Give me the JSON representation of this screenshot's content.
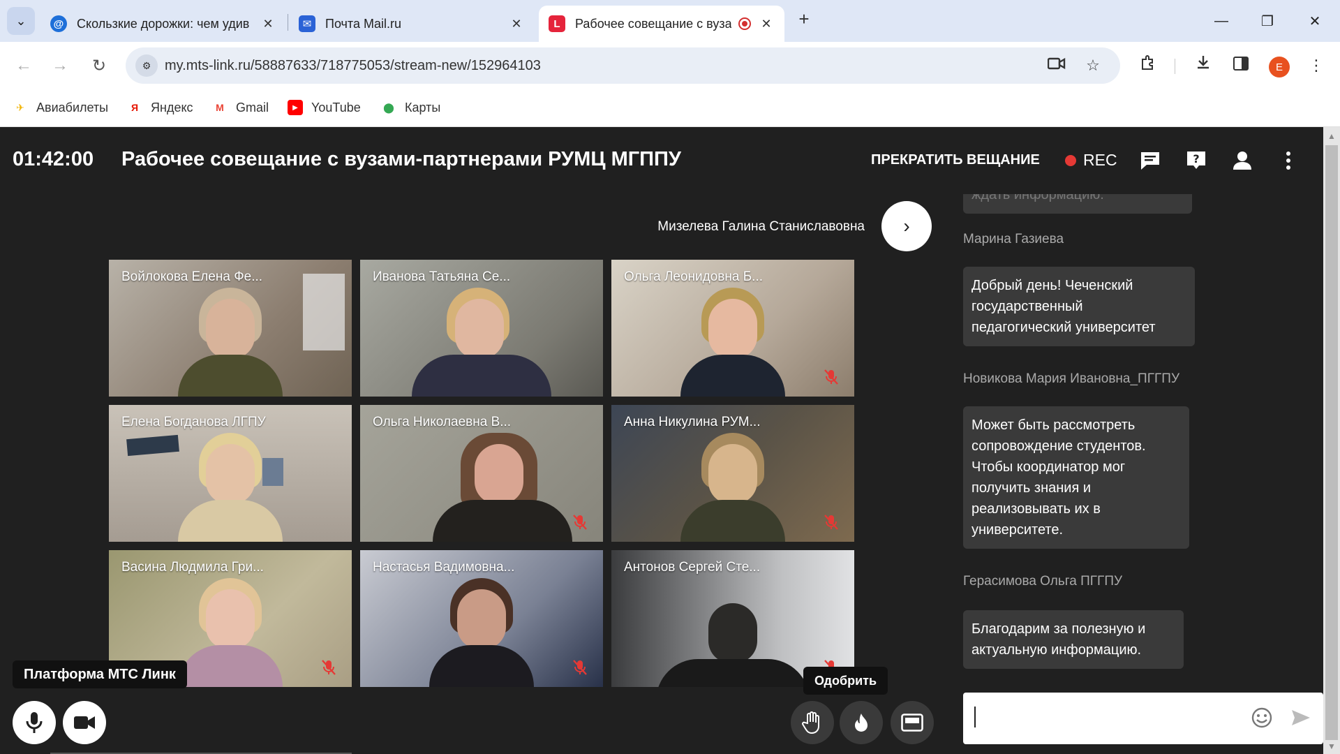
{
  "browser": {
    "tabs": [
      {
        "title": "Скользкие дорожки: чем удив",
        "favicon": "mail-at-icon"
      },
      {
        "title": "Почта Mail.ru",
        "favicon": "envelope-icon"
      },
      {
        "title": "Рабочее совещание с вуза",
        "favicon": "mts-link-icon"
      }
    ],
    "url": "my.mts-link.ru/58887633/718775053/stream-new/152964103",
    "profile_initial": "E",
    "bookmarks": [
      {
        "label": "Авиабилеты",
        "icon": "plane-icon"
      },
      {
        "label": "Яндекс",
        "icon": "yandex-icon"
      },
      {
        "label": "Gmail",
        "icon": "gmail-icon"
      },
      {
        "label": "YouTube",
        "icon": "youtube-icon"
      },
      {
        "label": "Карты",
        "icon": "maps-pin-icon"
      }
    ]
  },
  "webinar": {
    "timer": "01:42:00",
    "title": "Рабочее совещание с вузами-партнерами РУМЦ МГППУ",
    "stop_label": "ПРЕКРАТИТЬ ВЕЩАНИЕ",
    "rec_label": "REC",
    "current_speaker": "Мизелева Галина Станиславовна",
    "participants": [
      {
        "name": "Войлокова Елена Фе...",
        "muted": false
      },
      {
        "name": "Иванова Татьяна Се...",
        "muted": false
      },
      {
        "name": "Ольга Леонидовна Б...",
        "muted": true
      },
      {
        "name": "Елена Богданова ЛГПУ",
        "muted": false
      },
      {
        "name": "Ольга Николаевна В...",
        "muted": true
      },
      {
        "name": "Анна Никулина РУМ...",
        "muted": true
      },
      {
        "name": "Васина Людмила Гри...",
        "muted": true
      },
      {
        "name": "Настасья Вадимовна...",
        "muted": true
      },
      {
        "name": "Антонов Сергей Сте...",
        "muted": true
      }
    ],
    "brand_tooltip": "Платформа МТС Линк",
    "approve_tooltip": "Одобрить"
  },
  "chat": {
    "partial_message": "ждать информацию.",
    "messages": [
      {
        "author": "Марина Газиева",
        "text": "Добрый день! Чеченский государственный педагогический университет"
      },
      {
        "author": "Новикова Мария Ивановна_ПГГПУ",
        "text": "Может быть рассмотреть сопровождение студентов. Чтобы координатор мог получить знания и реализовывать их в университете."
      },
      {
        "author": "Герасимова Ольга ПГГПУ",
        "text": "Благодарим за полезную и актуальную информацию."
      }
    ]
  },
  "colors": {
    "app_bg": "#202020",
    "rec_dot": "#e53935",
    "mute_red": "#e53935",
    "chat_bubble": "#3a3a3a"
  }
}
